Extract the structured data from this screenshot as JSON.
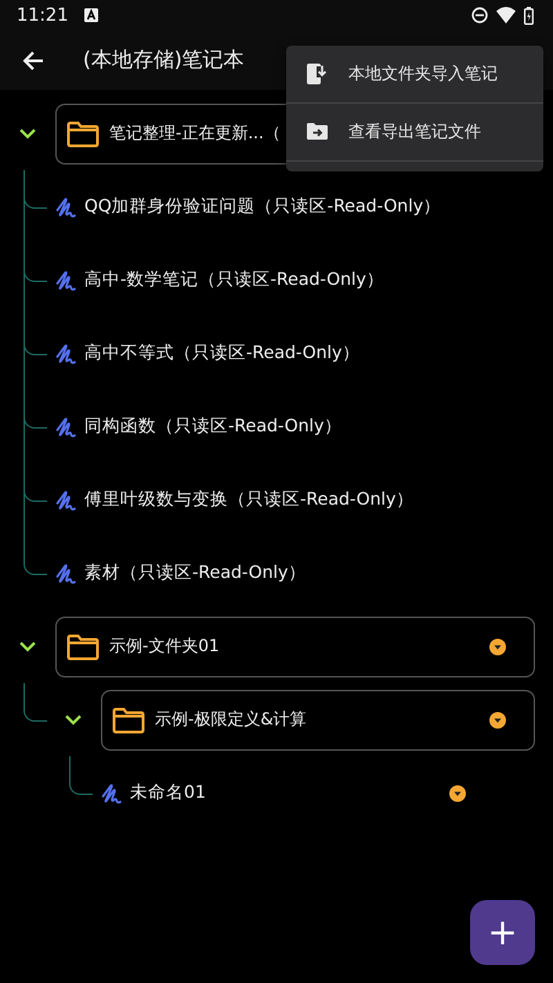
{
  "status_bar": {
    "time": "11:21"
  },
  "app_bar": {
    "title": "(本地存储)笔记本"
  },
  "tree": [
    {
      "kind": "folder",
      "name": "笔记整理-正在更新...（",
      "expanded": true,
      "menu_button": false,
      "children": [
        {
          "kind": "note",
          "name": "QQ加群身份验证问题（只读区-Read-Only）",
          "menu_button": false
        },
        {
          "kind": "note",
          "name": "高中-数学笔记（只读区-Read-Only）",
          "menu_button": false
        },
        {
          "kind": "note",
          "name": "高中不等式（只读区-Read-Only）",
          "menu_button": false
        },
        {
          "kind": "note",
          "name": "同构函数（只读区-Read-Only）",
          "menu_button": false
        },
        {
          "kind": "note",
          "name": "傅里叶级数与变换（只读区-Read-Only）",
          "menu_button": false
        },
        {
          "kind": "note",
          "name": "素材（只读区-Read-Only）",
          "menu_button": false
        }
      ]
    },
    {
      "kind": "folder",
      "name": "示例-文件夹01",
      "expanded": true,
      "menu_button": true,
      "children": [
        {
          "kind": "folder",
          "name": "示例-极限定义&计算",
          "expanded": true,
          "menu_button": true,
          "children": [
            {
              "kind": "note",
              "name": "未命名01",
              "menu_button": true
            }
          ]
        }
      ]
    }
  ],
  "menu": [
    {
      "kind": "import",
      "label": "本地文件夹导入笔记"
    },
    {
      "kind": "export",
      "label": "查看导出笔记文件"
    }
  ],
  "fab": {
    "label": "+"
  }
}
